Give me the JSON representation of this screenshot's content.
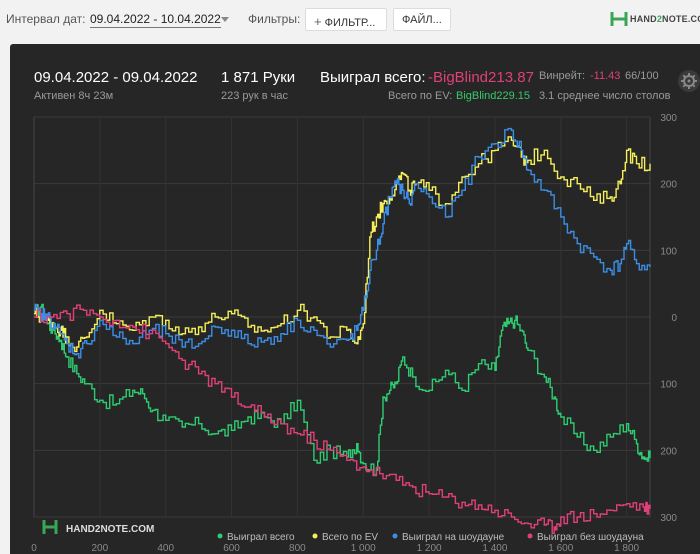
{
  "toolbar": {
    "interval_label": "Интервал дат:",
    "date_range": "09.04.2022 - 10.04.2022",
    "filters_label": "Фильтры:",
    "filter_button": "ФИЛЬТР...",
    "file_button": "ФАЙЛ...",
    "logo_prefix": "HAND",
    "logo_two": "2",
    "logo_suffix": "NOTE.COM"
  },
  "stats": {
    "date": "09.04.2022 - 09.04.2022",
    "active": "Активен 8ч 23м",
    "hands": "1 871 Руки",
    "hands_per_hour": "223 рук в час",
    "won_total_label": "Выиграл всего:",
    "won_total_value": "-BigBlind213.87",
    "ev_label": "Всего по EV:",
    "ev_value": "BigBlind229.15",
    "winrate_label": "Винрейт:",
    "winrate_value": "-11.43",
    "winrate_extra": "66/100",
    "avg_table": "3.1 среднее число столов"
  },
  "watermark": "HAND2NOTE.COM",
  "colors": {
    "panel": "#262626",
    "green": "#2ecc71",
    "yellow": "#f5ef5a",
    "blue": "#3a8ee6",
    "pink": "#e0407a"
  },
  "chart_data": {
    "type": "line",
    "x_ticks": [
      "0",
      "200",
      "400",
      "600",
      "800",
      "1 000",
      "1 200",
      "1 400",
      "1 600",
      "1 800"
    ],
    "y_ticks": [
      "300",
      "200",
      "100",
      "0",
      "100",
      "200",
      "300"
    ],
    "xlim": [
      0,
      1871
    ],
    "ylim": [
      -300,
      300
    ],
    "grid": true,
    "legend_position": "bottom",
    "series": [
      {
        "name": "Выиграл всего",
        "color": "#2ecc71",
        "x": [
          0,
          20,
          40,
          60,
          80,
          100,
          130,
          160,
          200,
          250,
          300,
          330,
          360,
          400,
          450,
          500,
          550,
          600,
          650,
          700,
          750,
          800,
          850,
          900,
          950,
          980,
          1000,
          1040,
          1060,
          1080,
          1100,
          1120,
          1150,
          1200,
          1250,
          1300,
          1350,
          1400,
          1420,
          1440,
          1460,
          1480,
          1500,
          1550,
          1580,
          1600,
          1650,
          1700,
          1750,
          1800,
          1830,
          1850,
          1871
        ],
        "values": [
          5,
          15,
          -10,
          -20,
          -35,
          -60,
          -85,
          -100,
          -125,
          -130,
          -110,
          -115,
          -140,
          -155,
          -165,
          -160,
          -175,
          -170,
          -150,
          -150,
          -160,
          -125,
          -215,
          -200,
          -210,
          -190,
          -220,
          -230,
          -120,
          -110,
          -100,
          -60,
          -90,
          -110,
          -80,
          -110,
          -70,
          -80,
          -20,
          -10,
          -5,
          -20,
          -50,
          -90,
          -120,
          -150,
          -180,
          -200,
          -180,
          -160,
          -190,
          -210,
          -212
        ]
      },
      {
        "name": "Всего по EV",
        "color": "#f5ef5a",
        "x": [
          0,
          20,
          40,
          60,
          80,
          100,
          130,
          160,
          200,
          250,
          300,
          350,
          400,
          450,
          500,
          550,
          600,
          650,
          700,
          750,
          800,
          850,
          900,
          950,
          980,
          1000,
          1020,
          1040,
          1060,
          1080,
          1100,
          1120,
          1140,
          1160,
          1200,
          1250,
          1300,
          1350,
          1400,
          1450,
          1480,
          1500,
          1550,
          1600,
          1650,
          1700,
          1750,
          1780,
          1800,
          1830,
          1871
        ],
        "values": [
          5,
          0,
          -5,
          -10,
          -20,
          -30,
          -45,
          -30,
          10,
          -10,
          -20,
          0,
          -5,
          -25,
          -15,
          0,
          5,
          -15,
          -20,
          -10,
          10,
          0,
          -30,
          -20,
          -40,
          -10,
          120,
          150,
          170,
          180,
          200,
          215,
          190,
          200,
          190,
          170,
          210,
          230,
          250,
          265,
          240,
          235,
          250,
          210,
          200,
          175,
          180,
          200,
          250,
          230,
          230
        ]
      },
      {
        "name": "Выиграл на шоудауне",
        "color": "#3a8ee6",
        "x": [
          0,
          20,
          40,
          60,
          80,
          100,
          130,
          160,
          200,
          250,
          300,
          350,
          400,
          450,
          500,
          550,
          600,
          650,
          700,
          750,
          800,
          850,
          900,
          950,
          980,
          1000,
          1020,
          1040,
          1060,
          1080,
          1100,
          1120,
          1140,
          1160,
          1200,
          1250,
          1300,
          1350,
          1400,
          1450,
          1480,
          1500,
          1550,
          1600,
          1650,
          1700,
          1750,
          1780,
          1800,
          1830,
          1871
        ],
        "values": [
          10,
          5,
          0,
          -10,
          -25,
          -40,
          -55,
          -40,
          -5,
          -30,
          -40,
          -20,
          -25,
          -45,
          -40,
          -15,
          -20,
          -40,
          -35,
          -25,
          -5,
          -20,
          -45,
          -35,
          -20,
          10,
          70,
          100,
          140,
          180,
          200,
          190,
          170,
          200,
          180,
          150,
          190,
          240,
          260,
          280,
          250,
          220,
          190,
          150,
          110,
          90,
          70,
          80,
          110,
          80,
          75
        ]
      },
      {
        "name": "Выиграл без шоудауна",
        "color": "#e0407a",
        "x": [
          0,
          50,
          100,
          150,
          200,
          250,
          300,
          350,
          400,
          450,
          500,
          550,
          600,
          650,
          700,
          750,
          800,
          850,
          900,
          950,
          1000,
          1050,
          1100,
          1150,
          1200,
          1250,
          1300,
          1350,
          1400,
          1450,
          1500,
          1550,
          1580,
          1600,
          1650,
          1700,
          1750,
          1800,
          1850,
          1871
        ],
        "values": [
          0,
          0,
          5,
          10,
          0,
          -5,
          -15,
          -25,
          -40,
          -65,
          -85,
          -100,
          -120,
          -135,
          -150,
          -160,
          -175,
          -185,
          -200,
          -215,
          -225,
          -235,
          -245,
          -255,
          -265,
          -270,
          -278,
          -282,
          -290,
          -300,
          -310,
          -312,
          -315,
          -300,
          -300,
          -295,
          -290,
          -280,
          -285,
          -288
        ]
      }
    ]
  }
}
